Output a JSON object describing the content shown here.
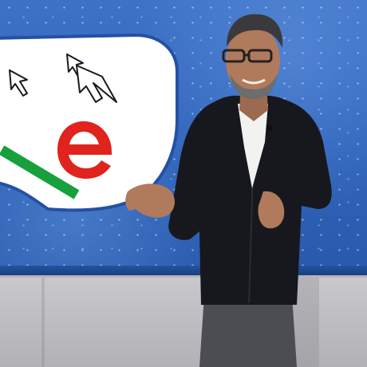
{
  "scene": {
    "description_tags": [
      "stage",
      "presenter",
      "led-screen"
    ],
    "screen_graphic": {
      "letter": "e",
      "letter_color": "#e0231c",
      "underline_color": "#17a03c",
      "bubble_color": "#ffffff",
      "bubble_outline_color": "#2450a6",
      "icons": [
        "cursor-arrow-icon",
        "double-cursor-arrow-icon"
      ]
    },
    "colors": {
      "screen_blue": "#3566bd",
      "jacket": "#17181d",
      "shirt": "#f2f2f0",
      "trousers": "#4b4d52",
      "skin": "#b07a5c"
    }
  }
}
